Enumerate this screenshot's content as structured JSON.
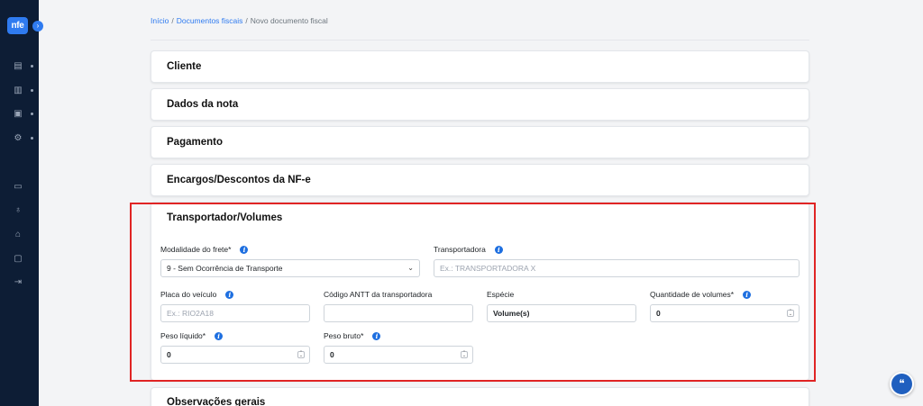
{
  "app": {
    "logo_text": "nfe"
  },
  "sidebar": {
    "icons": [
      "list-icon",
      "chart-icon",
      "folder-icon",
      "gear-icon",
      "chat-icon",
      "microphone-icon",
      "lock-icon",
      "monitor-icon",
      "logout-icon"
    ]
  },
  "breadcrumb": {
    "home": "Início",
    "docs": "Documentos fiscais",
    "current": "Novo documento fiscal",
    "separator": "/"
  },
  "sections": {
    "cliente": "Cliente",
    "dados_nota": "Dados da nota",
    "pagamento": "Pagamento",
    "encargos": "Encargos/Descontos da NF-e",
    "transportador": "Transportador/Volumes",
    "observacoes": "Observações gerais"
  },
  "form": {
    "modalidade_label": "Modalidade do frete*",
    "modalidade_value": "9 - Sem Ocorrência de Transporte",
    "transportadora_label": "Transportadora",
    "transportadora_placeholder": "Ex.: TRANSPORTADORA X",
    "placa_label": "Placa do veículo",
    "placa_placeholder": "Ex.: RIO2A18",
    "antt_label": "Código ANTT da transportadora",
    "antt_value": "",
    "especie_label": "Espécie",
    "especie_value": "Volume(s)",
    "qtd_volumes_label": "Quantidade de volumes*",
    "qtd_volumes_value": "0",
    "peso_liquido_label": "Peso líquido*",
    "peso_liquido_value": "0",
    "peso_bruto_label": "Peso bruto*",
    "peso_bruto_value": "0"
  },
  "colors": {
    "accent": "#2f7bf0",
    "sidebar": "#0d1d35",
    "highlight": "#e02424"
  }
}
